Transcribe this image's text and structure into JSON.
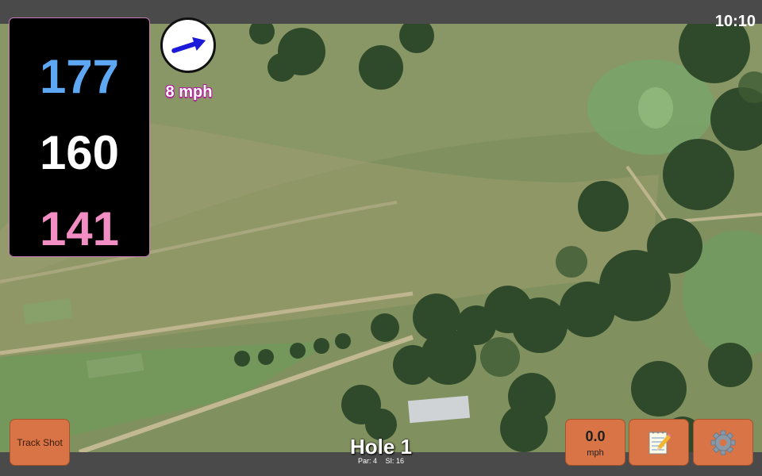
{
  "status": {
    "time": "10:10"
  },
  "distances": {
    "back": "177",
    "middle": "160",
    "front": "141"
  },
  "colors": {
    "back": "#5ea8f3",
    "middle": "#ffffff",
    "front": "#f28ec3",
    "button": "#d97446",
    "wind_arrow": "#1a1ad8"
  },
  "wind": {
    "speed_label": "8 mph",
    "direction_icon": "wind-arrow-icon"
  },
  "buttons": {
    "track_shot": "Track Shot",
    "speed_value": "0.0",
    "speed_unit": "mph",
    "notes_icon": "notepad-icon",
    "settings_icon": "gear-icon"
  },
  "hole": {
    "title": "Hole 1",
    "par_label": "Par: 4",
    "si_label": "SI: 16"
  }
}
